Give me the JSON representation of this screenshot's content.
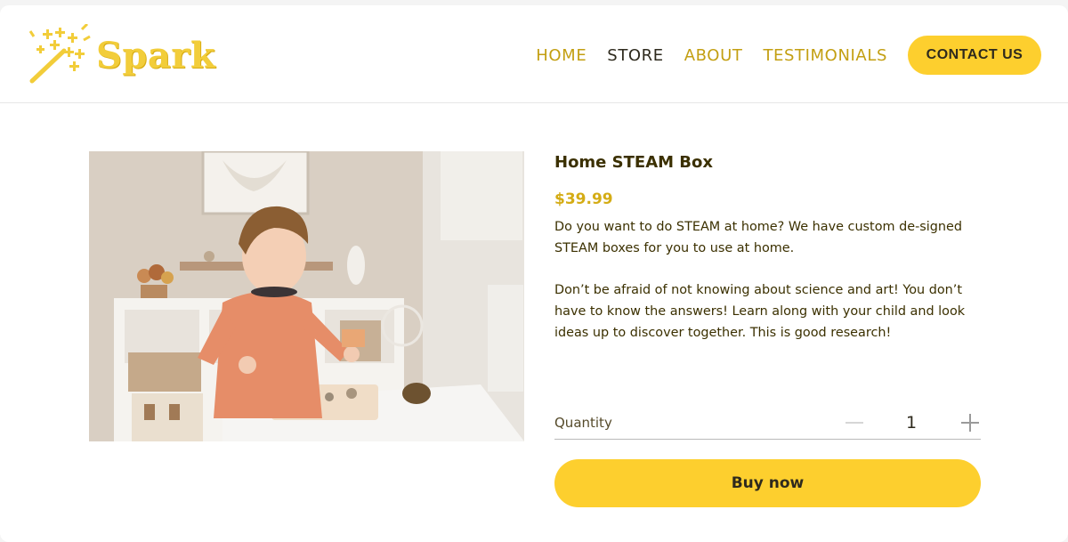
{
  "brand": {
    "name": "Spark"
  },
  "nav": {
    "items": [
      {
        "label": "HOME"
      },
      {
        "label": "STORE"
      },
      {
        "label": "ABOUT"
      },
      {
        "label": "TESTIMONIALS"
      }
    ],
    "active": "STORE",
    "contact_label": "CONTACT US"
  },
  "product": {
    "title": "Home STEAM Box",
    "price": "$39.99",
    "description": [
      "Do you want to do STEAM at home? We have custom de-signed STEAM boxes for you to use at home.",
      "Don’t be afraid of not knowing about science and art! You don’t have to know the answers! Learn along with your child and look ideas up to discover together. This is good research!"
    ],
    "image_icon": "product-photo-child-playing"
  },
  "quantity": {
    "label": "Quantity",
    "value": "1"
  },
  "buy_label": "Buy now",
  "colors": {
    "accent": "#fdcf2e",
    "accent_text": "#c39f12",
    "price": "#d4ac15",
    "text": "#3b3000"
  }
}
